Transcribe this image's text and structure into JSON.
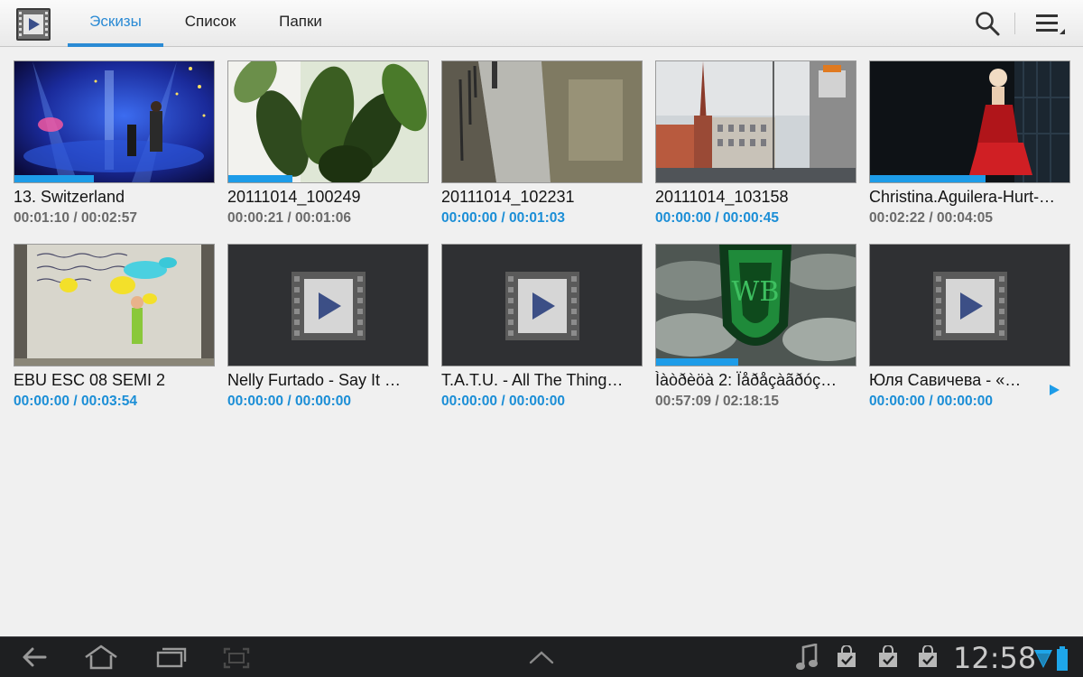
{
  "toolbar": {
    "tabs": [
      {
        "label": "Эскизы",
        "active": true
      },
      {
        "label": "Список",
        "active": false
      },
      {
        "label": "Папки",
        "active": false
      }
    ]
  },
  "accent_color": "#2a8ad4",
  "progress_color": "#1d9ce8",
  "videos": [
    {
      "title": "13. Switzerland",
      "time": "00:01:10 / 00:02:57",
      "progress": 0.4,
      "played": true,
      "thumbnail": "stage-performance"
    },
    {
      "title": "20111014_100249",
      "time": "00:00:21 / 00:01:06",
      "progress": 0.32,
      "played": true,
      "thumbnail": "plant-leaves"
    },
    {
      "title": "20111014_102231",
      "time": "00:00:00 / 00:01:03",
      "progress": 0,
      "played": false,
      "thumbnail": "sidewalk"
    },
    {
      "title": "20111014_103158",
      "time": "00:00:00 / 00:00:45",
      "progress": 0,
      "played": false,
      "thumbnail": "kremlin-street"
    },
    {
      "title": "Christina.Aguilera-Hurt-…",
      "time": "00:02:22 / 00:04:05",
      "progress": 0.58,
      "played": true,
      "thumbnail": "singer-red-dress"
    },
    {
      "title": "EBU ESC 08 SEMI 2",
      "time": "00:00:00 / 00:03:54",
      "progress": 0,
      "played": false,
      "thumbnail": "painted-wall"
    },
    {
      "title": "Nelly  Furtado -  Say It …",
      "time": "00:00:00 / 00:00:00",
      "progress": 0,
      "played": false,
      "thumbnail": "video-placeholder-icon"
    },
    {
      "title": "T.A.T.U. - All The Thing…",
      "time": "00:00:00 / 00:00:00",
      "progress": 0,
      "played": false,
      "thumbnail": "video-placeholder-icon"
    },
    {
      "title": "Ìàòðèöà 2: Ïåðåçàãðóç…",
      "time": "00:57:09 / 02:18:15",
      "progress": 0.41,
      "played": true,
      "thumbnail": "wb-logo-clouds"
    },
    {
      "title": "Юля Савичева - «…",
      "time": "00:00:00 / 00:00:00",
      "progress": 0,
      "played": false,
      "thumbnail": "video-placeholder-icon"
    }
  ],
  "statusbar": {
    "clock": "12:58",
    "icons": [
      "back-icon",
      "home-icon",
      "recent-apps-icon",
      "screenshot-icon",
      "expand-up-icon",
      "music-note-icon",
      "store-bag-icon",
      "store-bag-icon",
      "store-bag-icon",
      "wifi-icon",
      "battery-icon"
    ]
  }
}
